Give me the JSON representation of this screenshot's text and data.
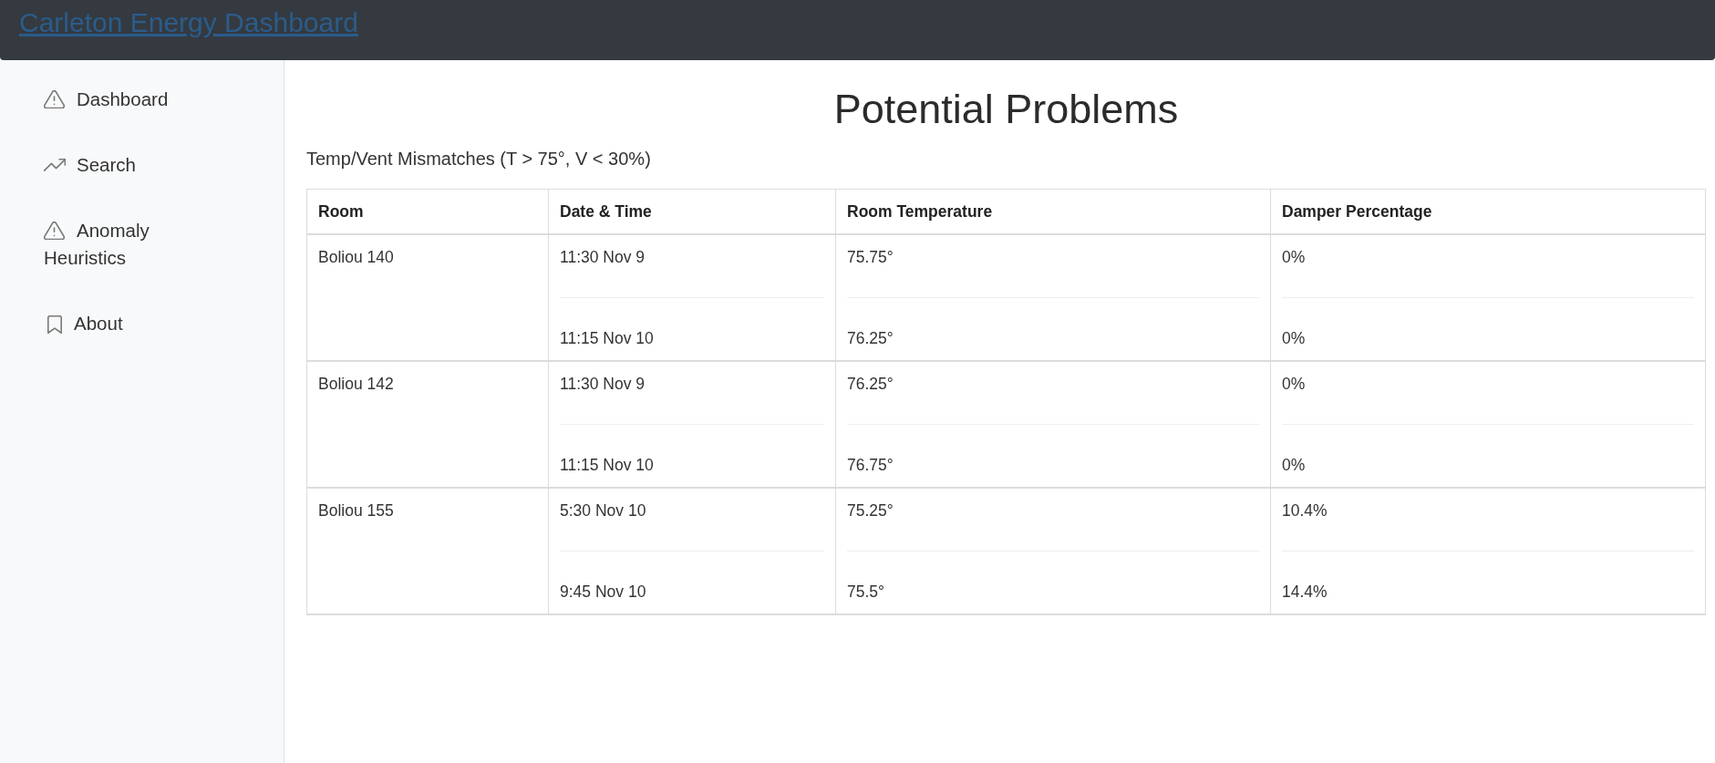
{
  "navbar": {
    "title": "Carleton Energy Dashboard"
  },
  "sidebar": {
    "items": [
      {
        "label": "Dashboard",
        "kind": "alert"
      },
      {
        "label": "Search",
        "kind": "trend"
      },
      {
        "label": "Anomaly Heuristics",
        "kind": "alert"
      },
      {
        "label": "About",
        "kind": "bookmark"
      }
    ]
  },
  "main": {
    "title": "Potential Problems",
    "caption": "Temp/Vent Mismatches (T > 75°, V < 30%)",
    "table": {
      "columns": [
        "Room",
        "Date & Time",
        "Room Temperature",
        "Damper Percentage"
      ],
      "rows": [
        {
          "room": "Boliou 140",
          "readings": [
            {
              "time": "11:30 Nov 9",
              "temperature": "75.75°",
              "damper": "0%"
            },
            {
              "time": "11:15 Nov 10",
              "temperature": "76.25°",
              "damper": "0%"
            }
          ]
        },
        {
          "room": "Boliou 142",
          "readings": [
            {
              "time": "11:30 Nov 9",
              "temperature": "76.25°",
              "damper": "0%"
            },
            {
              "time": "11:15 Nov 10",
              "temperature": "76.75°",
              "damper": "0%"
            }
          ]
        },
        {
          "room": "Boliou 155",
          "readings": [
            {
              "time": "5:30 Nov 10",
              "temperature": "75.25°",
              "damper": "10.4%"
            },
            {
              "time": "9:45 Nov 10",
              "temperature": "75.5°",
              "damper": "14.4%"
            }
          ]
        }
      ]
    }
  }
}
